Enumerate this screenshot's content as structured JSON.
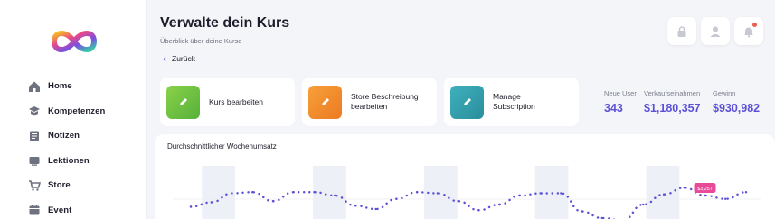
{
  "sidebar": {
    "items": [
      {
        "label": "Home",
        "icon": "home-icon"
      },
      {
        "label": "Kompetenzen",
        "icon": "hat-icon"
      },
      {
        "label": "Notizen",
        "icon": "notes-icon"
      },
      {
        "label": "Lektionen",
        "icon": "lessons-icon"
      },
      {
        "label": "Store",
        "icon": "cart-icon"
      },
      {
        "label": "Event",
        "icon": "calendar-icon"
      }
    ]
  },
  "header": {
    "title": "Verwalte dein Kurs",
    "subtitle": "Überblick über deine Kurse",
    "back_label": "Zurück"
  },
  "actions": [
    {
      "label": "Kurs bearbeiten",
      "color": "#6ec23f",
      "icon": "pencil-icon"
    },
    {
      "label": "Store Beschreibung bearbeiten",
      "color": "#f08a2c",
      "icon": "pencil-icon"
    },
    {
      "label": "Manage Subscription",
      "color": "#2e9aa8",
      "icon": "pencil-icon"
    }
  ],
  "stats": [
    {
      "label": "Neue User",
      "value": "343"
    },
    {
      "label": "Verkaufseinahmen",
      "value": "$1,180,357"
    },
    {
      "label": "Gewinn",
      "value": "$930,982"
    }
  ],
  "chart": {
    "title": "Durchschnittlicher Wochenumsatz",
    "tooltip": "$3,257",
    "accent": "#5b50d6",
    "tooltip_color": "#e84a97"
  },
  "chart_data": {
    "type": "line",
    "title": "Durchschnittlicher Wochenumsatz",
    "values": [
      14,
      18,
      26,
      27,
      19,
      27,
      27,
      24,
      15,
      12,
      21,
      27,
      26,
      19,
      11,
      16,
      24,
      26,
      26,
      10,
      4,
      2,
      16,
      25,
      31,
      24,
      21,
      27
    ],
    "highlight_index": 25,
    "ylim": [
      0,
      40
    ]
  }
}
